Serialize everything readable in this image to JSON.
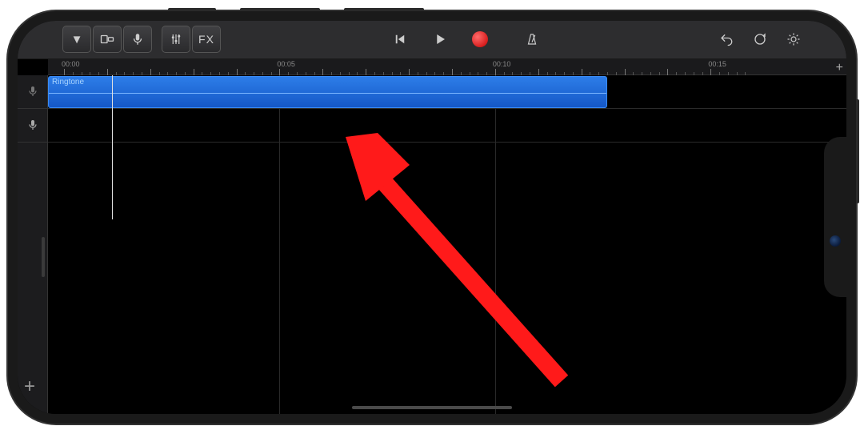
{
  "toolbar": {
    "dropdown": "▼",
    "fx_label": "FX"
  },
  "ruler": {
    "labels": [
      "00:00",
      "00:05",
      "00:10",
      "00:15"
    ],
    "positions_pct": [
      0,
      27,
      54,
      81
    ]
  },
  "tracks": [
    {
      "name": "Ringtone",
      "region_width_pct": 70,
      "has_region": true
    },
    {
      "name": "",
      "region_width_pct": 0,
      "has_region": false
    }
  ],
  "playhead_pct": 6.2,
  "grid_lines_pct": [
    27,
    54,
    81
  ],
  "icons": {
    "add": "+"
  }
}
